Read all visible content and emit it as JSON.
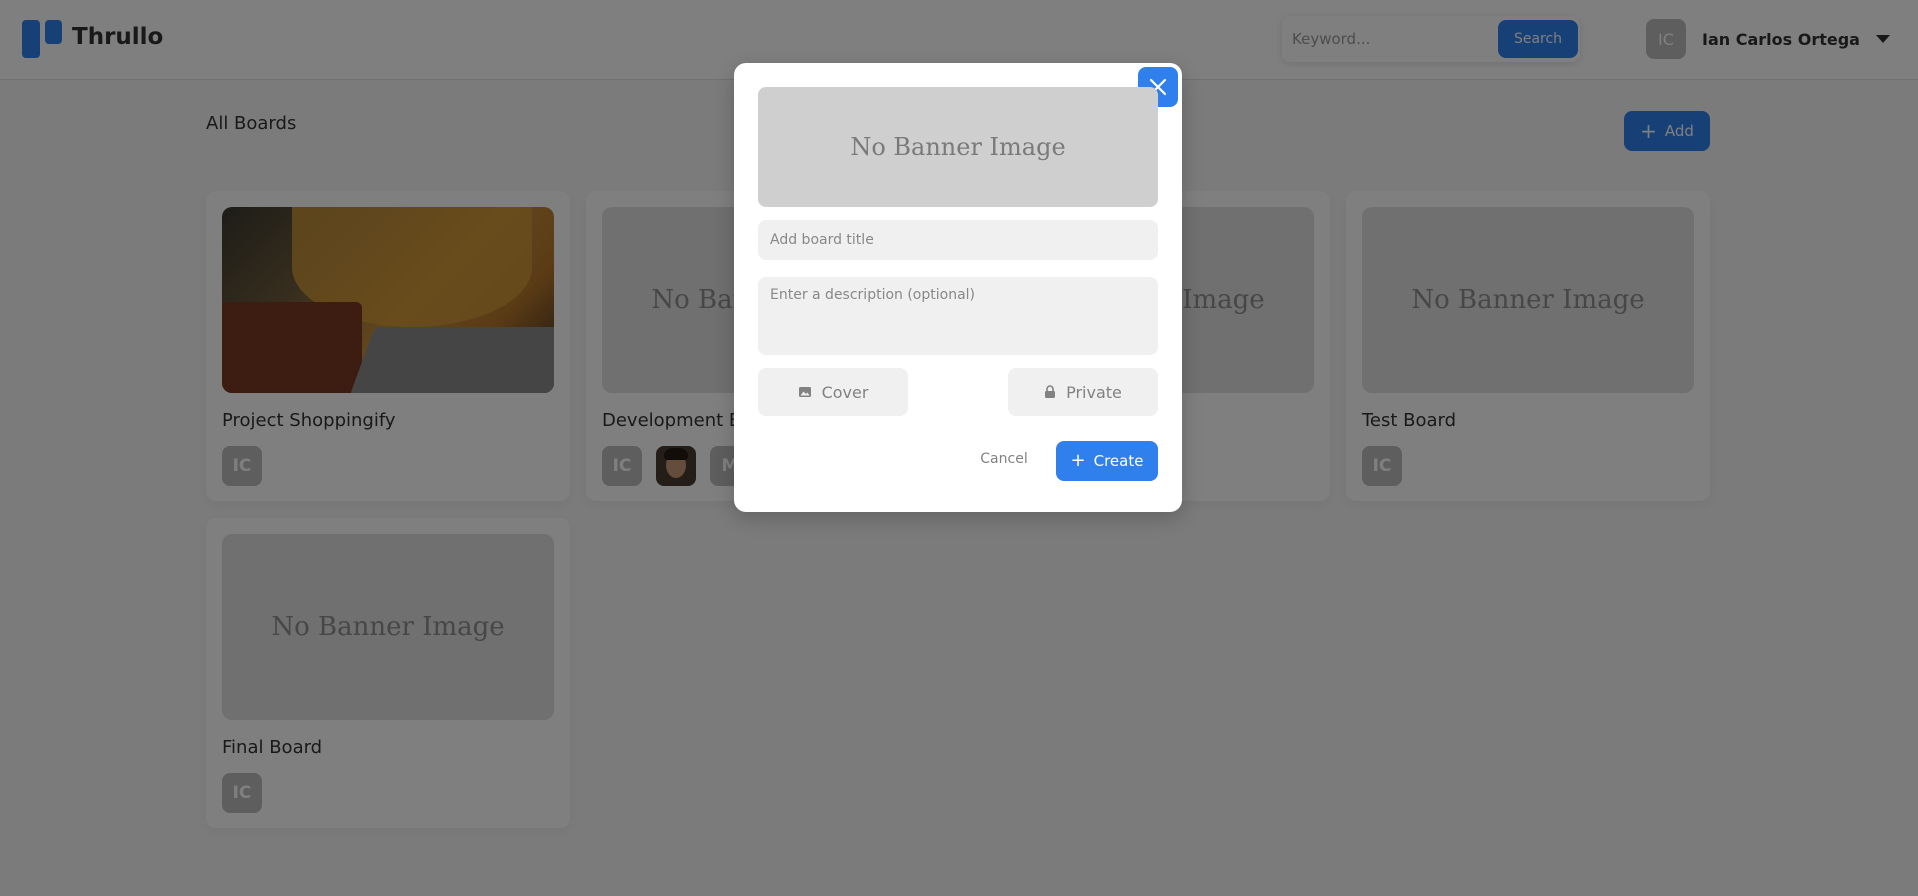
{
  "app": {
    "name": "Thrullo"
  },
  "search": {
    "placeholder": "Keyword...",
    "button_label": "Search"
  },
  "user": {
    "initials": "IC",
    "name": "Ian Carlos Ortega"
  },
  "main": {
    "title": "All Boards",
    "add_label": "Add",
    "boards": [
      {
        "title": "Project Shoppingify",
        "banner": "photo",
        "members": [
          "IC"
        ]
      },
      {
        "title": "Development Board",
        "banner_text": "No Banner Image",
        "members": [
          "IC",
          "photo",
          "M"
        ]
      },
      {
        "title": "",
        "banner_text": "No Banner Image",
        "members": []
      },
      {
        "title": "Test Board",
        "banner_text": "No Banner Image",
        "members": [
          "IC"
        ]
      },
      {
        "title": "Final Board",
        "banner_text": "No Banner Image",
        "members": [
          "IC"
        ]
      }
    ]
  },
  "modal": {
    "banner_text": "No Banner Image",
    "title_placeholder": "Add board title",
    "description_placeholder": "Enter a description (optional)",
    "cover_label": "Cover",
    "private_label": "Private",
    "cancel_label": "Cancel",
    "create_label": "Create"
  },
  "colors": {
    "accent": "#2f80ed",
    "overlay": "rgba(0,0,0,0.5)"
  }
}
